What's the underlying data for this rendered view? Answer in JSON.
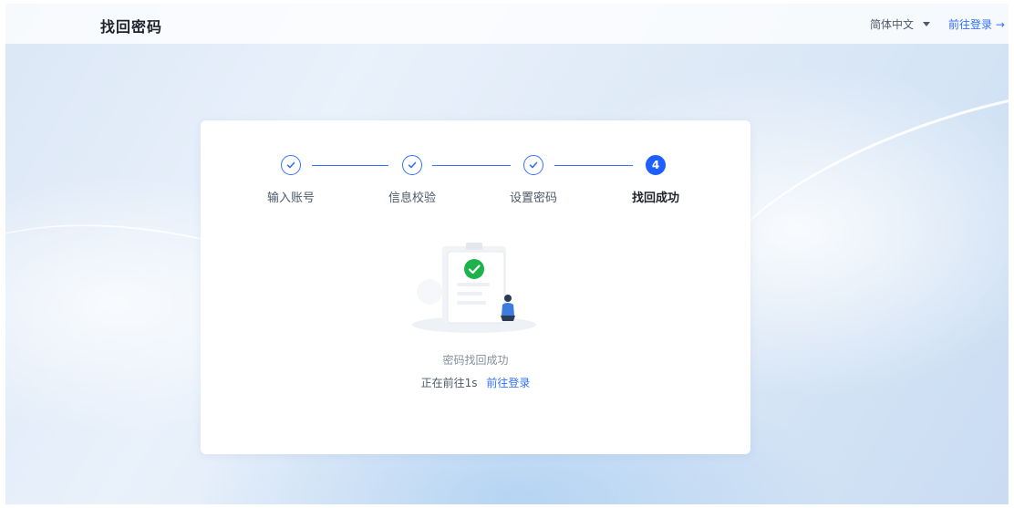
{
  "header": {
    "title": "找回密码",
    "language": "简体中文",
    "login_link": "前往登录 →"
  },
  "steps": [
    {
      "label": "输入账号",
      "state": "done"
    },
    {
      "label": "信息校验",
      "state": "done"
    },
    {
      "label": "设置密码",
      "state": "done"
    },
    {
      "label": "找回成功",
      "state": "active",
      "number": "4"
    }
  ],
  "result": {
    "message": "密码找回成功",
    "redirect_text": "正在前往1s",
    "redirect_link": "前往登录"
  },
  "colors": {
    "accent": "#3370ff",
    "success": "#1db34b"
  },
  "icons": {
    "step_done": "check-icon",
    "success": "check-circle-icon",
    "language": "caret-down-icon"
  }
}
